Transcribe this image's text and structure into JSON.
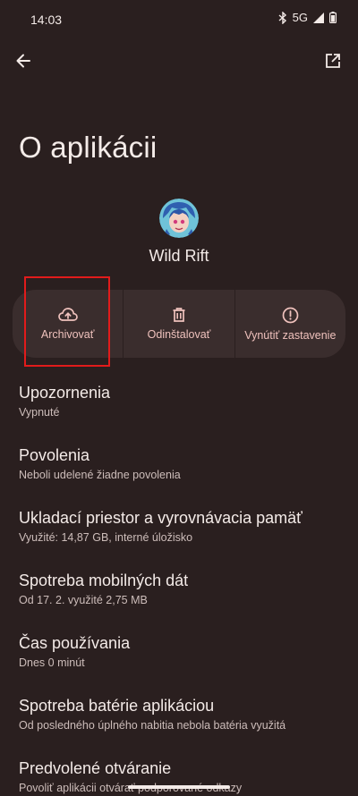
{
  "status": {
    "time": "14:03",
    "network": "5G",
    "icons": [
      "bluetooth-icon",
      "signal-icon",
      "battery-icon"
    ]
  },
  "page": {
    "title": "O aplikácii"
  },
  "app": {
    "name": "Wild Rift",
    "icon": "wild-rift-app-icon"
  },
  "actions": [
    {
      "label": "Archivovať",
      "icon": "cloud-upload-icon"
    },
    {
      "label": "Odinštalovať",
      "icon": "trash-icon"
    },
    {
      "label": "Vynútiť zastavenie",
      "icon": "alert-circle-icon"
    }
  ],
  "settings": [
    {
      "title": "Upozornenia",
      "subtitle": "Vypnuté"
    },
    {
      "title": "Povolenia",
      "subtitle": "Neboli udelené žiadne povolenia"
    },
    {
      "title": "Ukladací priestor a vyrovnávacia pamäť",
      "subtitle": "Využité: 14,87 GB, interné úložisko"
    },
    {
      "title": "Spotreba mobilných dát",
      "subtitle": "Od 17. 2. využité 2,75 MB"
    },
    {
      "title": "Čas používania",
      "subtitle": "Dnes 0 minút"
    },
    {
      "title": "Spotreba batérie aplikáciou",
      "subtitle": "Od posledného úplného nabitia nebola batéria využitá"
    },
    {
      "title": "Predvolené otváranie",
      "subtitle": "Povoliť aplikácii otvárať podporované odkazy"
    }
  ],
  "colors": {
    "background": "#2a1f1f",
    "action_surface": "#3a2d2d",
    "accent": "#f0c2bd",
    "highlight_box": "#e11b1b"
  }
}
